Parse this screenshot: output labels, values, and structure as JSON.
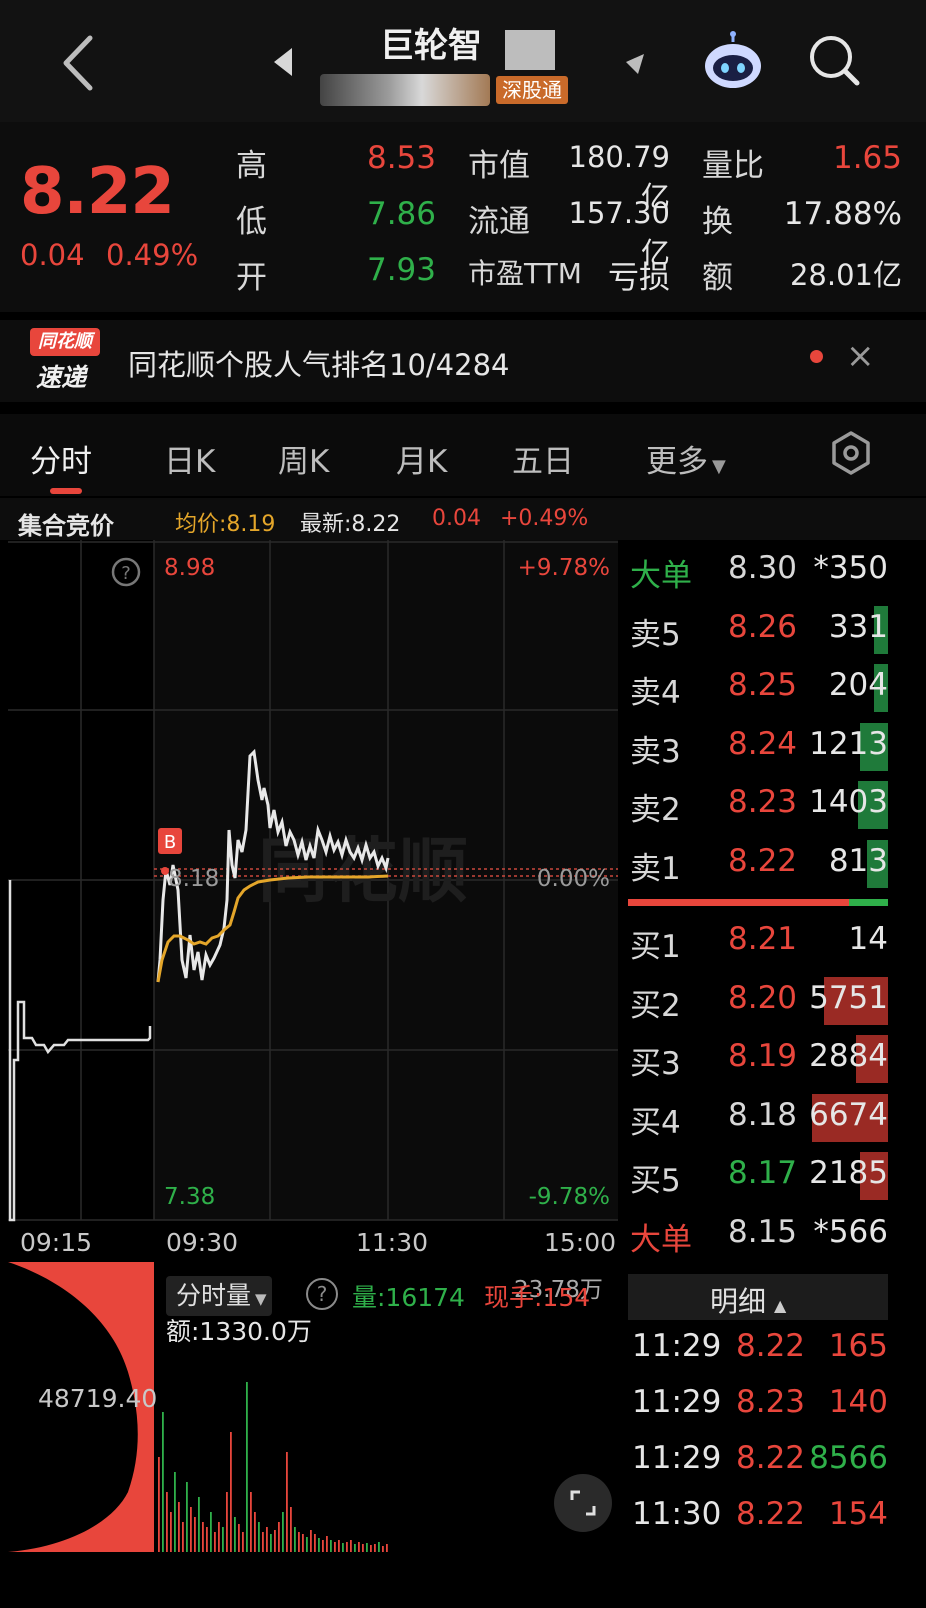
{
  "header": {
    "stock_name": "巨轮智能",
    "stock_name_visible": "巨轮智",
    "badge": "深股通"
  },
  "quote": {
    "price": "8.22",
    "change": "0.04",
    "change_pct": "0.49%",
    "rows": [
      {
        "l1": "高",
        "v1": "8.53",
        "l2": "市值",
        "v2": "180.79亿",
        "l3": "量比",
        "v3": "1.65"
      },
      {
        "l1": "低",
        "v1": "7.86",
        "l2": "流通",
        "v2": "157.30亿",
        "l3": "换",
        "v3": "17.88%"
      },
      {
        "l1": "开",
        "v1": "7.93",
        "l2": "市盈TTM",
        "v2": "亏损",
        "l3": "额",
        "v3": "28.01亿"
      }
    ]
  },
  "news": {
    "logo_top": "同花顺",
    "logo_bottom": "速递",
    "text": "同花顺个股人气排名10/4284",
    "close": "×"
  },
  "tabs": [
    "分时",
    "日K",
    "周K",
    "月K",
    "五日",
    "更多"
  ],
  "info_bar": {
    "auction": "集合竞价",
    "avg": "均价:8.19",
    "last": "最新:8.22",
    "chg": "0.04",
    "pct": "+0.49%"
  },
  "chart": {
    "top_price": "8.98",
    "bottom_price": "7.38",
    "top_pct": "+9.78%",
    "bottom_pct": "-9.78%",
    "ref_price": "8.18",
    "ref_pct": "0.00%",
    "buy_marker": "B",
    "help": "?",
    "watermark": "同花顺",
    "time_labels": [
      "09:15",
      "09:30",
      "11:30",
      "15:00"
    ]
  },
  "volume": {
    "selector": "分时量",
    "help": "?",
    "qty": "量:16174",
    "current": "现手:154",
    "overlay_amount": "23.78万",
    "amount": "额:1330.0万",
    "left_value": "48719.40"
  },
  "order_book": {
    "big_sell": {
      "label": "大单",
      "price": "8.30",
      "vol": "*350"
    },
    "sells": [
      {
        "label": "卖5",
        "price": "8.26",
        "vol": "331",
        "bar": 0.05
      },
      {
        "label": "卖4",
        "price": "8.25",
        "vol": "204",
        "bar": 0.04
      },
      {
        "label": "卖3",
        "price": "8.24",
        "vol": "1213",
        "bar": 0.12
      },
      {
        "label": "卖2",
        "price": "8.23",
        "vol": "1403",
        "bar": 0.13
      },
      {
        "label": "卖1",
        "price": "8.22",
        "vol": "813",
        "bar": 0.09
      }
    ],
    "buys": [
      {
        "label": "买1",
        "price": "8.21",
        "vol": "14",
        "bar": 0.0
      },
      {
        "label": "买2",
        "price": "8.20",
        "vol": "5751",
        "bar": 0.28
      },
      {
        "label": "买3",
        "price": "8.19",
        "vol": "2884",
        "bar": 0.14
      },
      {
        "label": "买4",
        "price": "8.18",
        "vol": "6674",
        "bar": 0.33
      },
      {
        "label": "买5",
        "price": "8.17",
        "vol": "2185",
        "bar": 0.12
      }
    ],
    "big_buy": {
      "label": "大单",
      "price": "8.15",
      "vol": "*566"
    },
    "ratio_red": 0.85
  },
  "detail": {
    "title": "明细",
    "rows": [
      {
        "time": "11:29",
        "price": "8.22",
        "vol": "165"
      },
      {
        "time": "11:29",
        "price": "8.23",
        "vol": "140"
      },
      {
        "time": "11:29",
        "price": "8.22",
        "vol": "8566"
      },
      {
        "time": "11:30",
        "price": "8.22",
        "vol": "154"
      }
    ]
  },
  "colors": {
    "up": "#e8463c",
    "down": "#2fb04a",
    "avg": "#e4a62a"
  }
}
